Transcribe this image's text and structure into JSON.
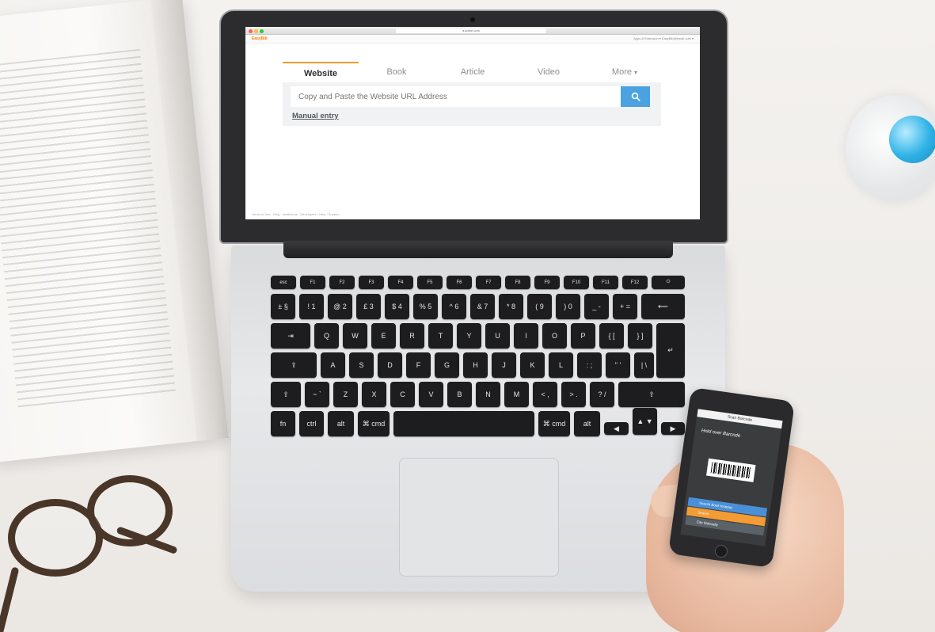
{
  "browser": {
    "url": "a.sdme.com",
    "brand": "EasyBib",
    "toolbar_right": "Apps & Extension ▾   EasyBib@email.com ▾"
  },
  "citation": {
    "tabs": [
      {
        "label": "Website",
        "active": true
      },
      {
        "label": "Book",
        "active": false
      },
      {
        "label": "Article",
        "active": false
      },
      {
        "label": "Video",
        "active": false
      },
      {
        "label": "More",
        "active": false
      }
    ],
    "search_placeholder": "Copy and Paste the Website URL Address",
    "manual_entry": "Manual entry",
    "footer": "Terms of Use · Blog · Institutions · Developers · Help / Support"
  },
  "keyboard": {
    "fn_row": [
      "esc",
      "F1",
      "F2",
      "F3",
      "F4",
      "F5",
      "F6",
      "F7",
      "F8",
      "F9",
      "F10",
      "F11",
      "F12",
      "⏻"
    ],
    "num_row": [
      "± §",
      "! 1",
      "@ 2",
      "£ 3",
      "$ 4",
      "% 5",
      "^ 6",
      "& 7",
      "* 8",
      "( 9",
      ") 0",
      "_ -",
      "+ =",
      "⟵"
    ],
    "top_row": [
      "⇥",
      "Q",
      "W",
      "E",
      "R",
      "T",
      "Y",
      "U",
      "I",
      "O",
      "P",
      "{ [",
      "} ]",
      "↵"
    ],
    "home_row": [
      "⇪",
      "A",
      "S",
      "D",
      "F",
      "G",
      "H",
      "J",
      "K",
      "L",
      ": ;",
      "\" '",
      "| \\"
    ],
    "bottom_row": [
      "⇧",
      "~ `",
      "Z",
      "X",
      "C",
      "V",
      "B",
      "N",
      "M",
      "< ,",
      "> .",
      "? /",
      "⇧"
    ],
    "space_row": [
      "fn",
      "ctrl",
      "alt",
      "⌘ cmd",
      "",
      "⌘ cmd",
      "alt",
      "◀",
      "▲ ▼",
      "▶"
    ]
  },
  "phone": {
    "title": "Scan Barcode",
    "hint": "Hold over Barcode",
    "buttons": [
      {
        "label": "Search Book Instead",
        "color": "#4a90d9"
      },
      {
        "label": "Search",
        "color": "#f39c34"
      },
      {
        "label": "Cite Manually",
        "color": "#5b6268"
      }
    ]
  }
}
